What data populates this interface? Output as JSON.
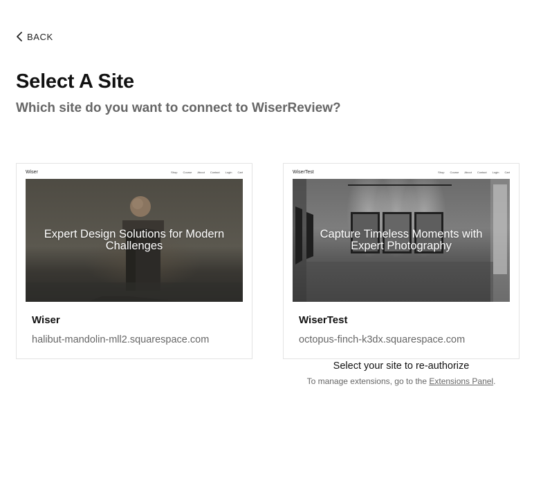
{
  "back": {
    "label": "BACK",
    "icon": "chevron-left-icon"
  },
  "header": {
    "title": "Select A Site",
    "subtitle": "Which site do you want to connect to WiserReview?"
  },
  "sites": [
    {
      "name": "Wiser",
      "domain": "halibut-mandolin-mll2.squarespace.com",
      "preview": {
        "logo": "Wiser",
        "nav": [
          "Shop",
          "Course",
          "About",
          "Contact",
          "Login",
          "Cart"
        ],
        "headline": "Expert Design Solutions for Modern Challenges"
      }
    },
    {
      "name": "WiserTest",
      "domain": "octopus-finch-k3dx.squarespace.com",
      "preview": {
        "logo": "WiserTest",
        "nav": [
          "Shop",
          "Course",
          "About",
          "Contact",
          "Login",
          "Cart"
        ],
        "headline": "Capture Timeless Moments with Expert Photography"
      }
    }
  ],
  "footer": {
    "reauthorize": "Select your site to re-authorize",
    "manage_prefix": "To manage extensions, go to the ",
    "manage_link": "Extensions Panel",
    "manage_suffix": "."
  }
}
